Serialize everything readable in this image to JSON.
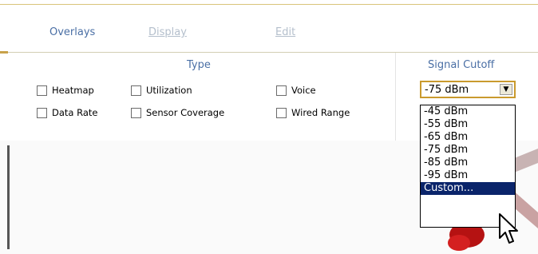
{
  "tabs": {
    "overlays": "Overlays",
    "display": "Display",
    "edit": "Edit"
  },
  "type_section": {
    "title": "Type",
    "checkboxes": [
      {
        "label": "Heatmap",
        "checked": false
      },
      {
        "label": "Utilization",
        "checked": false
      },
      {
        "label": "Voice",
        "checked": false
      },
      {
        "label": "Data Rate",
        "checked": false
      },
      {
        "label": "Sensor Coverage",
        "checked": false
      },
      {
        "label": "Wired Range",
        "checked": false
      }
    ]
  },
  "signal_cutoff": {
    "title": "Signal Cutoff",
    "selected": "-75 dBm",
    "options": [
      "-45 dBm",
      "-55 dBm",
      "-65 dBm",
      "-75 dBm",
      "-85 dBm",
      "-95 dBm",
      "Custom..."
    ],
    "highlighted": "Custom..."
  },
  "icons": {
    "dropdown_arrow": "chevron-down-icon",
    "cursor": "mouse-pointer-icon",
    "checkbox": "checkbox-icon"
  },
  "colors": {
    "tab_active": "#4a6fa5",
    "tab_inactive": "#b4bfcc",
    "select_border": "#c99a2e",
    "highlight": "#0a246a"
  }
}
